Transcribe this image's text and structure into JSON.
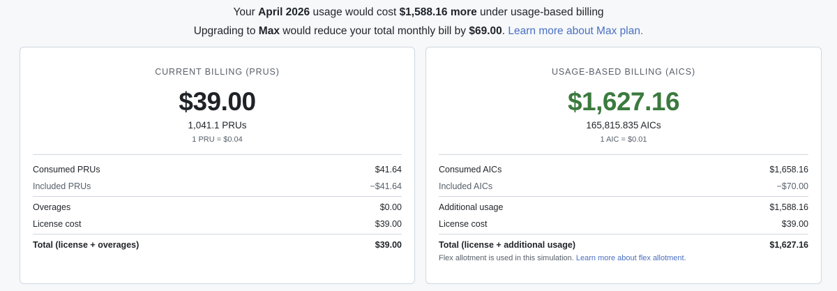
{
  "banner": {
    "line1": {
      "prefix": "Your ",
      "month": "April 2026",
      "middle": " usage would cost ",
      "amount": "$1,588.16 more",
      "suffix": " under usage-based billing"
    },
    "line2": {
      "prefix": "Upgrading to ",
      "plan": "Max",
      "middle": " would reduce your total monthly bill by ",
      "amount": "$69.00",
      "punct": ".",
      "link": "Learn more about Max plan."
    }
  },
  "current": {
    "title": "CURRENT BILLING (PRUS)",
    "amount": "$39.00",
    "units": "1,041.1 PRUs",
    "rate": "1 PRU = $0.04",
    "rows": [
      {
        "label": "Consumed PRUs",
        "value": "$41.64"
      },
      {
        "label": "Included PRUs",
        "value": "−$41.64"
      },
      {
        "label": "Overages",
        "value": "$0.00"
      },
      {
        "label": "License cost",
        "value": "$39.00"
      },
      {
        "label": "Total (license + overages)",
        "value": "$39.00"
      }
    ]
  },
  "usage": {
    "title": "USAGE-BASED BILLING (AICS)",
    "amount": "$1,627.16",
    "amount_color": "#3b7a3e",
    "units": "165,815.835 AICs",
    "rate": "1 AIC = $0.01",
    "rows": [
      {
        "label": "Consumed AICs",
        "value": "$1,658.16"
      },
      {
        "label": "Included AICs",
        "value": "−$70.00"
      },
      {
        "label": "Additional usage",
        "value": "$1,588.16"
      },
      {
        "label": "License cost",
        "value": "$39.00"
      },
      {
        "label": "Total (license + additional usage)",
        "value": "$1,627.16"
      }
    ],
    "footnote": {
      "text": "Flex allotment is used in this simulation. ",
      "link": "Learn more about flex allotment."
    }
  },
  "colors": {
    "link": "#4a6fc0",
    "accent_green": "#3b7a3e"
  }
}
